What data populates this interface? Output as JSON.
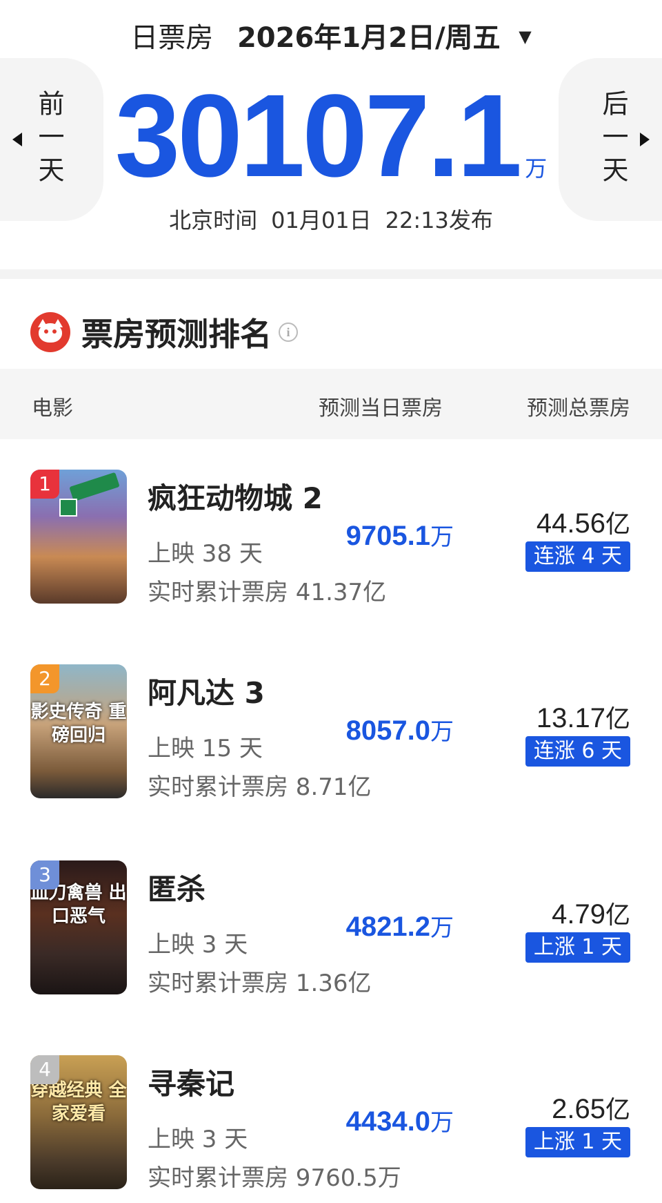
{
  "header": {
    "label": "日票房",
    "date": "2026年1月2日/周五",
    "caret": "▼",
    "prev_label": "前一天",
    "next_label": "后一天",
    "total_value": "30107.1",
    "total_unit": "万",
    "publish_prefix": "北京时间",
    "publish_date": "01月01日",
    "publish_time": "22:13发布"
  },
  "section": {
    "title": "票房预测排名",
    "info_icon": "i"
  },
  "table": {
    "col_movie": "电影",
    "col_day": "预测当日票房",
    "col_total": "预测总票房"
  },
  "movies": [
    {
      "rank": "1",
      "title": "疯狂动物城 2",
      "days": "上映 38 天",
      "cumulative": "实时累计票房 41.37亿",
      "day_box": "9705.1",
      "day_unit": "万",
      "total_box": "44.56",
      "total_unit": "亿",
      "trend": "连涨 4 天",
      "rank_color": "#e8323c"
    },
    {
      "rank": "2",
      "title": "阿凡达 3",
      "days": "上映 15 天",
      "cumulative": "实时累计票房 8.71亿",
      "day_box": "8057.0",
      "day_unit": "万",
      "total_box": "13.17",
      "total_unit": "亿",
      "trend": "连涨 6 天",
      "poster_text": "影史传奇 重磅回归",
      "rank_color": "#f3962b"
    },
    {
      "rank": "3",
      "title": "匿杀",
      "days": "上映 3 天",
      "cumulative": "实时累计票房 1.36亿",
      "day_box": "4821.2",
      "day_unit": "万",
      "total_box": "4.79",
      "total_unit": "亿",
      "trend": "上涨 1 天",
      "poster_text": "血刀禽兽 出口恶气",
      "rank_color": "#6f8fd8"
    },
    {
      "rank": "4",
      "title": "寻秦记",
      "days": "上映 3 天",
      "cumulative": "实时累计票房 9760.5万",
      "day_box": "4434.0",
      "day_unit": "万",
      "total_box": "2.65",
      "total_unit": "亿",
      "trend": "上涨 1 天",
      "poster_text": "穿越经典 全家爱看",
      "rank_color": "#bdbdbd"
    }
  ],
  "colors": {
    "accent": "#1a56e0",
    "logo": "#e23a2e"
  }
}
